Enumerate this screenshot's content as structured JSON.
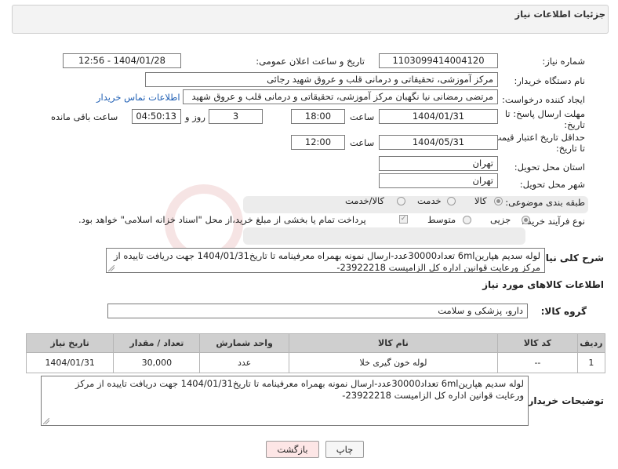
{
  "header": {
    "title": "جزئیات اطلاعات نیاز"
  },
  "form": {
    "need_number": {
      "label": "شماره نیاز:",
      "value": "1103099414004120"
    },
    "announce": {
      "label": "تاریخ و ساعت اعلان عمومی:",
      "value": "1404/01/28 - 12:56"
    },
    "buyer": {
      "label": "نام دستگاه خریدار:",
      "value": "مرکز آموزشی، تحقیقاتی و درمانی قلب و عروق شهید رجائی"
    },
    "creator": {
      "label": "ایجاد کننده درخواست:",
      "value": "مرتضی رمضانی نیا نگهبان مرکز آموزشی، تحقیقاتی و درمانی قلب و عروق شهید",
      "contact_link": "اطلاعات تماس خریدار"
    },
    "deadline": {
      "label_line1": "مهلت ارسال پاسخ: تا",
      "label_line2": "تاریخ:",
      "date": "1404/01/31",
      "time_label": "ساعت",
      "time": "18:00",
      "days": "3",
      "days_label": "روز و",
      "remaining": "04:50:13",
      "remaining_label": "ساعت باقی مانده"
    },
    "price_validity": {
      "label_line1": "حداقل تاریخ اعتبار قیمت:",
      "label_line2": "تا تاریخ:",
      "date": "1404/05/31",
      "time_label": "ساعت",
      "time": "12:00"
    },
    "province": {
      "label": "استان محل تحویل:",
      "value": "تهران"
    },
    "city": {
      "label": "شهر محل تحویل:",
      "value": "تهران"
    },
    "category": {
      "label": "طبقه بندی موضوعی:",
      "options": [
        "کالا",
        "خدمت",
        "کالا/خدمت"
      ],
      "selected": "کالا"
    },
    "process": {
      "label": "نوع فرآیند خرید :",
      "options": [
        "جزیی",
        "متوسط"
      ],
      "selected": "جزیی",
      "payment_note": "پرداخت تمام یا بخشی از مبلغ خرید،از محل \"اسناد خزانه اسلامی\" خواهد بود."
    }
  },
  "summary": {
    "label": "شرح کلی نیاز:",
    "text": "لوله سدیم هپارین6ml تعداد30000عدد-ارسال نمونه بهمراه معرفینامه تا تاریخ1404/01/31 جهت دریافت تاییده از مرکز ورعایت قوانین اداره کل الزامیست 23922218-"
  },
  "goods": {
    "section_title": "اطلاعات کالاهای مورد نیاز",
    "group_label": "گروه کالا:",
    "group_value": "دارو، پزشکی و سلامت",
    "columns": [
      "ردیف",
      "کد کالا",
      "نام کالا",
      "واحد شمارش",
      "تعداد / مقدار",
      "تاریخ نیاز"
    ],
    "rows": [
      {
        "row": "1",
        "code": "--",
        "name": "لوله خون گیری خلا",
        "unit": "عدد",
        "qty": "30,000",
        "date": "1404/01/31"
      }
    ]
  },
  "buyer_notes": {
    "label": "توضیحات خریدار:",
    "text": "لوله سدیم هپارین6ml تعداد30000عدد-ارسال نمونه بهمراه معرفینامه تا تاریخ1404/01/31 جهت دریافت تاییده از مرکز ورعایت قوانین اداره کل الزامیست 23922218-"
  },
  "buttons": {
    "print": "چاپ",
    "back": "بازگشت"
  },
  "colors": {
    "link": "#1f5fb4",
    "back_button_bg": "#fde6e6",
    "header_bg": "#f3f3f3",
    "table_header_bg": "#cfcfcf"
  }
}
